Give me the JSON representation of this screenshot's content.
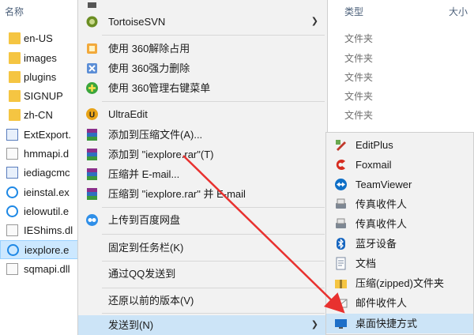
{
  "explorer": {
    "col_name": "名称",
    "col_type": "类型",
    "col_size": "大小",
    "files": [
      {
        "name": "en-US",
        "type": "folder"
      },
      {
        "name": "images",
        "type": "folder"
      },
      {
        "name": "plugins",
        "type": "folder"
      },
      {
        "name": "SIGNUP",
        "type": "folder"
      },
      {
        "name": "zh-CN",
        "type": "folder"
      },
      {
        "name": "ExtExport.",
        "type": "exe"
      },
      {
        "name": "hmmapi.d",
        "type": "dll"
      },
      {
        "name": "iediagcmc",
        "type": "exe"
      },
      {
        "name": "ieinstal.ex",
        "type": "ie"
      },
      {
        "name": "ielowutil.e",
        "type": "ie"
      },
      {
        "name": "IEShims.dl",
        "type": "dll"
      },
      {
        "name": "iexplore.e",
        "type": "ie",
        "selected": true
      },
      {
        "name": "sqmapi.dll",
        "type": "dll"
      }
    ],
    "types": [
      "文件夹",
      "文件夹",
      "文件夹",
      "文件夹",
      "文件夹"
    ]
  },
  "context_menu": {
    "items": [
      {
        "label": "TortoiseSVN",
        "icon": "tortoisesvn-icon",
        "arrow": "❯"
      },
      {
        "label": "使用 360解除占用",
        "icon": "360-unlock-icon"
      },
      {
        "label": "使用 360强力删除",
        "icon": "360-delete-icon"
      },
      {
        "label": "使用 360管理右键菜单",
        "icon": "360-menu-manage-icon"
      },
      {
        "label": "UltraEdit",
        "icon": "ultraedit-icon"
      },
      {
        "label": "添加到压缩文件(A)...",
        "icon": "winrar-icon"
      },
      {
        "label": "添加到 \"iexplore.rar\"(T)",
        "icon": "winrar-icon"
      },
      {
        "label": "压缩并 E-mail...",
        "icon": "winrar-icon"
      },
      {
        "label": "压缩到 \"iexplore.rar\" 并 E-mail",
        "icon": "winrar-icon"
      },
      {
        "label": "上传到百度网盘",
        "icon": "baidu-netdisk-icon"
      },
      {
        "label": "固定到任务栏(K)"
      },
      {
        "label": "通过QQ发送到"
      },
      {
        "label": "还原以前的版本(V)"
      },
      {
        "label": "发送到(N)",
        "arrow": "❯"
      }
    ]
  },
  "sendto_menu": {
    "items": [
      {
        "label": "EditPlus",
        "icon": "editplus-icon"
      },
      {
        "label": "Foxmail",
        "icon": "foxmail-icon"
      },
      {
        "label": "TeamViewer",
        "icon": "teamviewer-icon"
      },
      {
        "label": "传真收件人",
        "icon": "fax-icon"
      },
      {
        "label": "传真收件人",
        "icon": "fax-icon"
      },
      {
        "label": "蓝牙设备",
        "icon": "bluetooth-icon"
      },
      {
        "label": "文档",
        "icon": "documents-icon"
      },
      {
        "label": "压缩(zipped)文件夹",
        "icon": "zip-folder-icon"
      },
      {
        "label": "邮件收件人",
        "icon": "mail-recipient-icon"
      },
      {
        "label": "桌面快捷方式",
        "icon": "desktop-shortcut-icon"
      }
    ]
  },
  "colors": {
    "accent_arrow": "#e8312f",
    "highlight": "#cce4f7",
    "menu_bg": "#f2f2f2"
  }
}
